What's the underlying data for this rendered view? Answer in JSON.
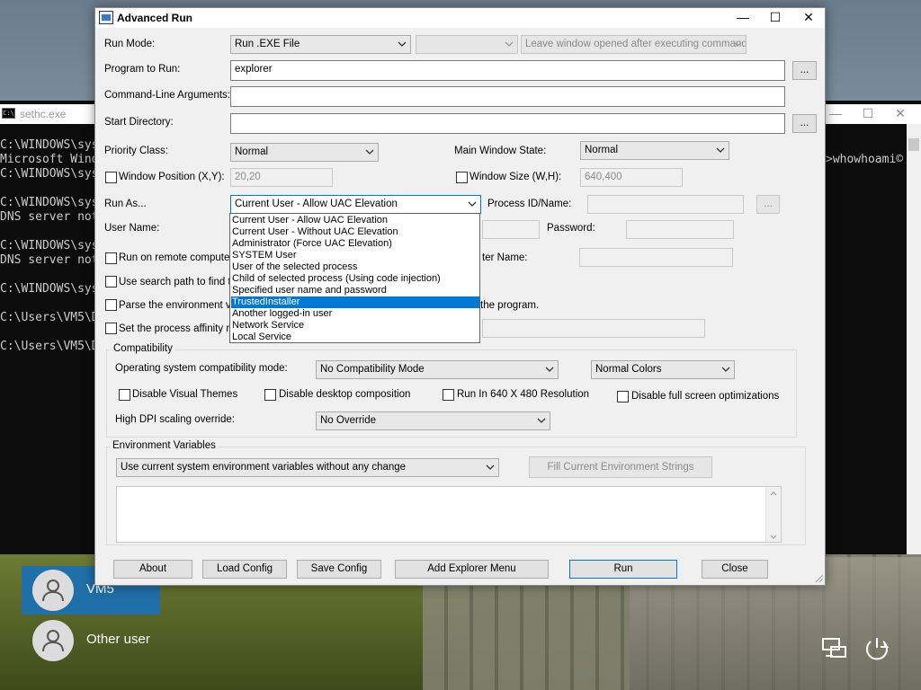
{
  "cmd": {
    "title": "sethc.exe",
    "icon_text": "C:\\",
    "lines": [
      "C:\\WINDOWS\\sys",
      "Microsoft Wind",
      "C:\\WINDOWS\\sys",
      "C:\\WINDOWS\\sys",
      "DNS server not",
      "C:\\WINDOWS\\sys",
      "DNS server not",
      "C:\\WINDOWS\\sys",
      "C:\\Users\\VM5\\D",
      "C:\\Users\\VM5\\D"
    ],
    "right_fragment": ">whowhoami©"
  },
  "users": [
    {
      "name": "VM5"
    },
    {
      "name": "Other user"
    }
  ],
  "dialog": {
    "title": "Advanced Run",
    "run_mode": {
      "label": "Run Mode:",
      "value": "Run .EXE File",
      "second": "",
      "third": "Leave window opened after executing command"
    },
    "program": {
      "label": "Program to Run:",
      "value": "explorer",
      "browse": "..."
    },
    "args": {
      "label": "Command-Line Arguments:",
      "value": ""
    },
    "start_dir": {
      "label": "Start Directory:",
      "value": "",
      "browse": "..."
    },
    "priority": {
      "label": "Priority Class:",
      "value": "Normal"
    },
    "main_state": {
      "label": "Main Window State:",
      "value": "Normal"
    },
    "win_pos": {
      "label": "Window Position (X,Y):",
      "value": "20,20"
    },
    "win_size": {
      "label": "Window Size (W,H):",
      "value": "640,400"
    },
    "run_as": {
      "label": "Run As...",
      "value": "Current User - Allow UAC Elevation"
    },
    "process_id": {
      "label": "Process ID/Name:",
      "value": "",
      "browse": "..."
    },
    "user_name": {
      "label": "User Name:"
    },
    "password": {
      "label": "Password:"
    },
    "remote": {
      "label": "Run on remote computer",
      "right_label": "ter Name:"
    },
    "search_path": {
      "label": "Use search path to find th"
    },
    "parse_env": {
      "label": "Parse the environment va",
      "right_label": "the program."
    },
    "affinity": {
      "label": "Set the process affinity m"
    },
    "run_as_options": [
      "Current User - Allow UAC Elevation",
      "Current User - Without UAC Elevation",
      "Administrator (Force UAC Elevation)",
      "SYSTEM User",
      "User of the selected process",
      "Child of selected process (Using code injection)",
      "Specified user name and password",
      "TrustedInstaller",
      "Another logged-in user",
      "Network Service",
      "Local Service"
    ],
    "highlighted_option": "TrustedInstaller",
    "compat": {
      "group": "Compatibility",
      "os_label": "Operating system compatibility mode:",
      "os_value": "No Compatibility Mode",
      "colors_value": "Normal Colors",
      "disable_themes": "Disable Visual Themes",
      "disable_composition": "Disable desktop composition",
      "run_640": "Run In 640 X 480 Resolution",
      "disable_fullscreen": "Disable full screen optimizations",
      "dpi_label": "High DPI scaling override:",
      "dpi_value": "No Override"
    },
    "env": {
      "group": "Environment Variables",
      "mode": "Use current system environment variables without any change",
      "fill_button": "Fill Current Environment Strings"
    },
    "buttons": {
      "about": "About",
      "load": "Load Config",
      "save": "Save Config",
      "explorer_menu": "Add Explorer Menu",
      "run": "Run",
      "close": "Close"
    }
  }
}
